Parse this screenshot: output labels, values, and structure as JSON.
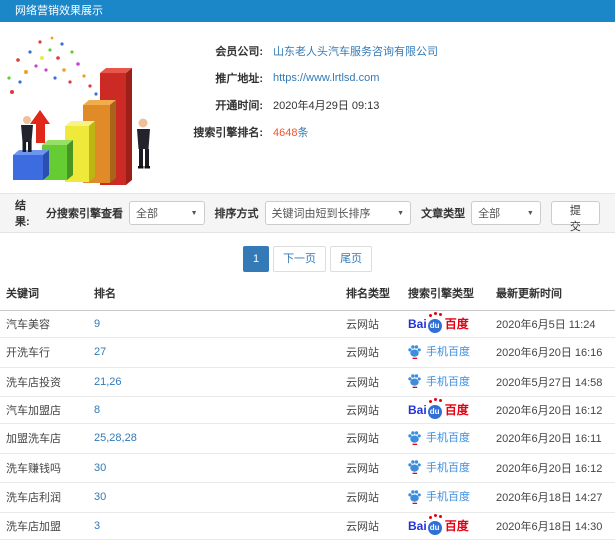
{
  "header": {
    "title": "网络营销效果展示"
  },
  "info": {
    "company_label": "会员公司:",
    "company_value": "山东老人头汽车服务咨询有限公司",
    "url_label": "推广地址:",
    "url_value": "https://www.lrtlsd.com",
    "open_time_label": "开通时间:",
    "open_time_value": "2020年4月29日 09:13",
    "rank_label": "搜索引擎排名:",
    "rank_count": "4648",
    "rank_unit": "条"
  },
  "filters": {
    "result_label": "结果:",
    "engine_filter_label": "分搜索引擎查看",
    "engine_filter_value": "全部",
    "sort_label": "排序方式",
    "sort_value": "关键词由短到长排序",
    "article_type_label": "文章类型",
    "article_type_value": "全部",
    "submit_label": "提交"
  },
  "pagination": {
    "current": "1",
    "next_label": "下一页",
    "last_label": "尾页"
  },
  "table": {
    "columns": [
      "关键词",
      "排名",
      "排名类型",
      "搜索引擎类型",
      "最新更新时间"
    ],
    "engines": {
      "baidu": {
        "latin": "Bai",
        "du": "du",
        "cn": "百度"
      },
      "mobile_baidu": {
        "label": "手机百度"
      }
    },
    "rows": [
      {
        "keyword": "汽车美容",
        "rank": "9",
        "rank_type": "云网站",
        "engine": "baidu",
        "updated": "2020年6月5日 11:24"
      },
      {
        "keyword": "开洗车行",
        "rank": "27",
        "rank_type": "云网站",
        "engine": "mobile_baidu",
        "updated": "2020年6月20日 16:16"
      },
      {
        "keyword": "洗车店投资",
        "rank": "21,26",
        "rank_type": "云网站",
        "engine": "mobile_baidu",
        "updated": "2020年5月27日 14:58"
      },
      {
        "keyword": "汽车加盟店",
        "rank": "8",
        "rank_type": "云网站",
        "engine": "baidu",
        "updated": "2020年6月20日 16:12"
      },
      {
        "keyword": "加盟洗车店",
        "rank": "25,28,28",
        "rank_type": "云网站",
        "engine": "mobile_baidu",
        "updated": "2020年6月20日 16:11"
      },
      {
        "keyword": "洗车赚钱吗",
        "rank": "30",
        "rank_type": "云网站",
        "engine": "mobile_baidu",
        "updated": "2020年6月20日 16:12"
      },
      {
        "keyword": "洗车店利润",
        "rank": "30",
        "rank_type": "云网站",
        "engine": "mobile_baidu",
        "updated": "2020年6月18日 14:27"
      },
      {
        "keyword": "洗车店加盟",
        "rank": "3",
        "rank_type": "云网站",
        "engine": "baidu",
        "updated": "2020年6月18日 14:30"
      }
    ]
  },
  "colors": {
    "header_bg": "#1b86c8",
    "link": "#337ab7",
    "rank_highlight": "#f4562a",
    "baidu_blue": "#2433d6",
    "baidu_red": "#e60012",
    "mobile_blue": "#3c8dde"
  }
}
